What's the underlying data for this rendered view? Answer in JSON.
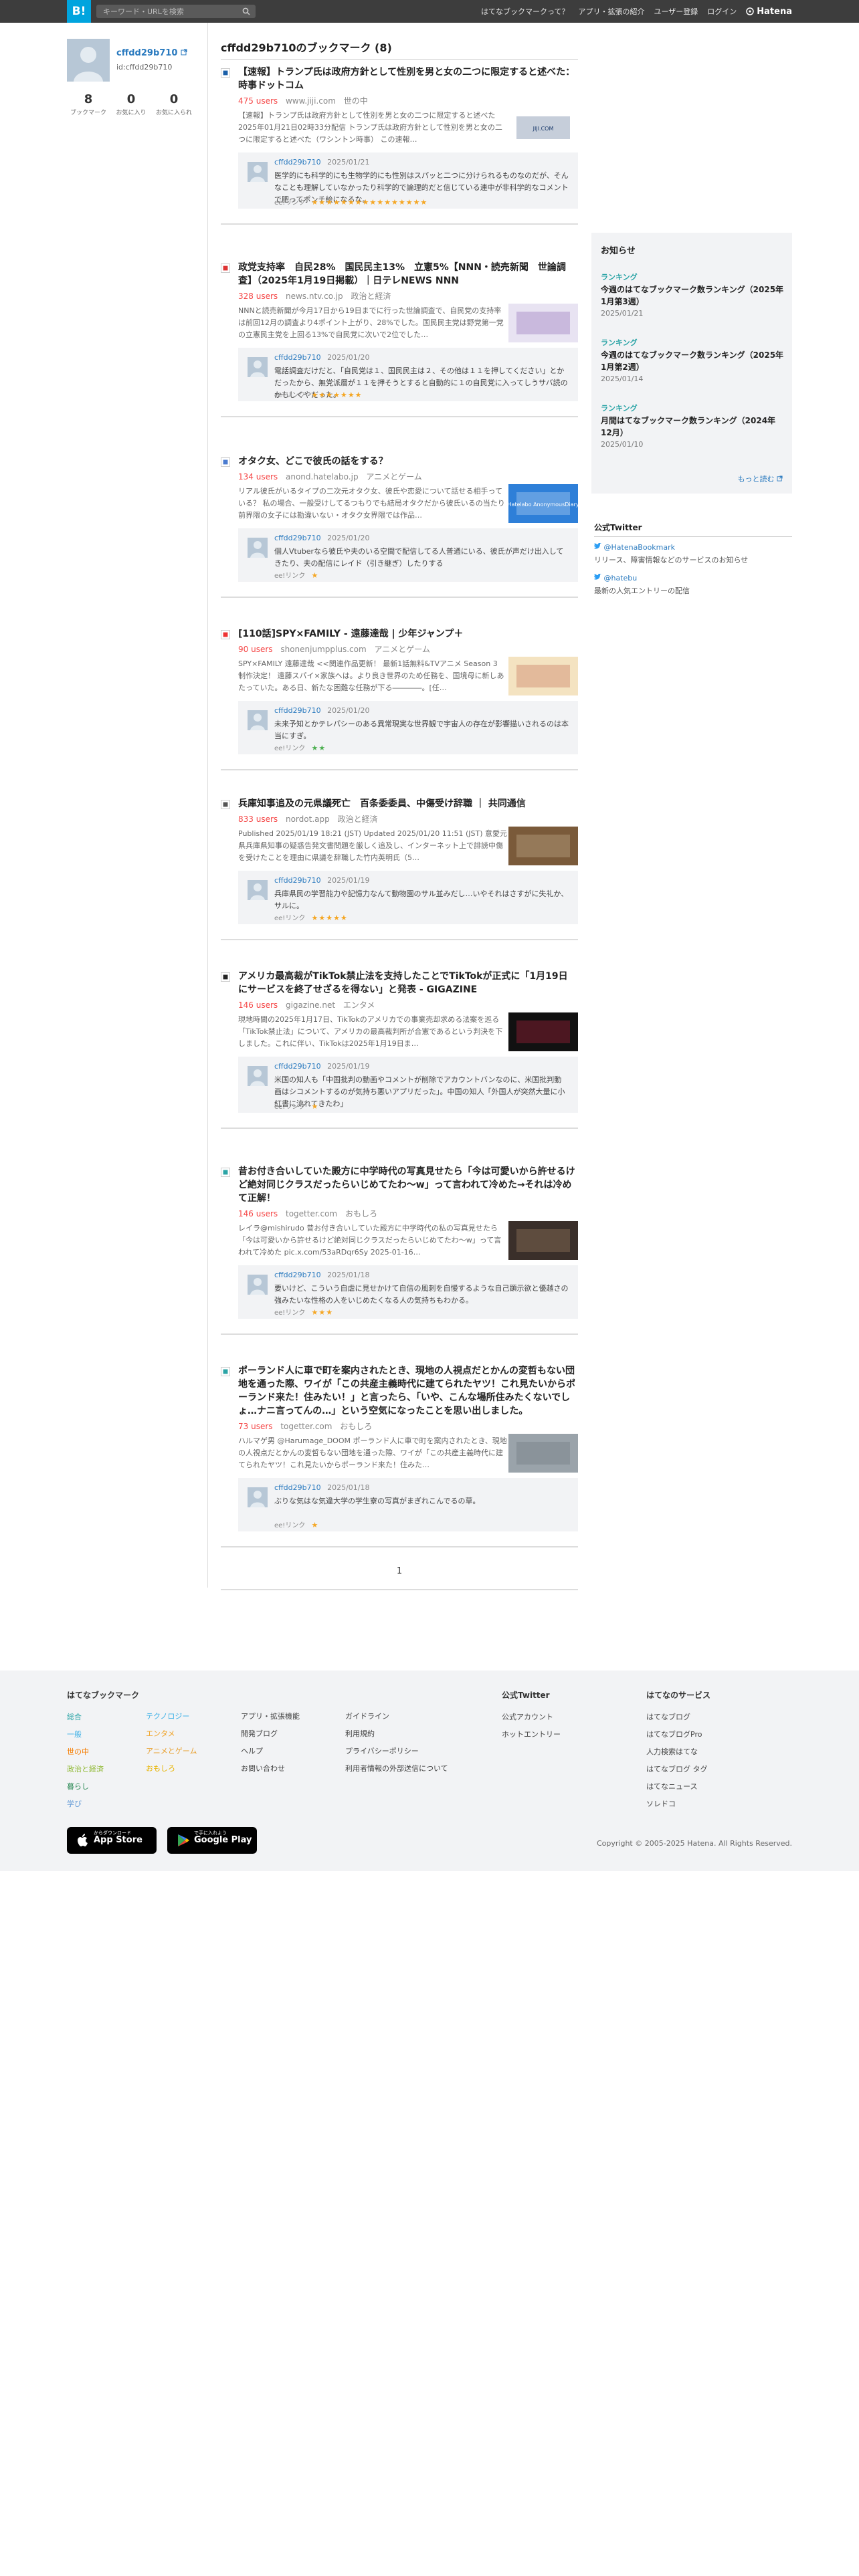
{
  "topbar": {
    "logo": "B!",
    "search_placeholder": "キーワード・URLを検索",
    "nav": [
      "はてなブックマークって？",
      "アプリ・拡張の紹介",
      "ユーザー登録",
      "ログイン"
    ],
    "brand": "Hatena"
  },
  "profile": {
    "name": "cffdd29b710",
    "id_text": "id:cffdd29b710",
    "stats": [
      {
        "value": "8",
        "label": "ブックマーク"
      },
      {
        "value": "0",
        "label": "お気に入り"
      },
      {
        "value": "0",
        "label": "お気に入られ"
      }
    ]
  },
  "main": {
    "title": "cffdd29b710のブックマーク (8)",
    "entries": [
      {
        "title": "【速報】トランプ氏は政府方針として性別を男と女の二つに限定すると述べた：時事ドットコム",
        "users": "475 users",
        "site": "www.jiji.com",
        "category": "世の中",
        "excerpt": "【速報】トランプ氏は政府方針として性別を男と女の二つに限定すると述べた 2025年01月21日02時33分配信 トランプ氏は政府方針として性別を男と女の二つに限定すると述べた（ワシントン時事） この速報…",
        "thumb_text": "JIJI.COM",
        "comment_user": "cffdd29b710",
        "comment_date": "2025/01/21",
        "comment_text": "医学的にも科学的にも生物学的にも性別はスパッと二つに分けられるものなのだが、そんなことも理解していなかったり科学的で論理的だと信じている連中が非科学的なコメントで肥ってポンチ絵になるな。",
        "tag": "ee!リンク",
        "stars": "★★★★★★★★★★★★★★★★",
        "star_color": "#f5a623"
      },
      {
        "title": "政党支持率　自民28%　国民民主13%　立憲5%【NNN・読売新聞　世論調査】（2025年1月19日掲載）｜日テレNEWS NNN",
        "users": "328 users",
        "site": "news.ntv.co.jp",
        "category": "政治と経済",
        "excerpt": "NNNと読売新聞が今月17日から19日までに行った世論調査で、自民党の支持率は前回12月の調査より4ポイント上がり、28%でした。国民民主党は野党第一党の立憲民主党を上回る13%で自民党に次いで2位でした…",
        "thumb_text": "",
        "comment_user": "cffdd29b710",
        "comment_date": "2025/01/20",
        "comment_text": "電話調査だけだと、「自民党は１、国民民主は２、その他は１１を押してください」とかだったから、無党派層が１１を押そうとすると自動的に１の自民党に入ってしうサバ読のかもしくやだった。",
        "tag": "ee!リンク",
        "stars": "★★★★★★★",
        "star_color": "#f5a623"
      },
      {
        "title": "オタク女、どこで彼氏の話をする？",
        "users": "134 users",
        "site": "anond.hatelabo.jp",
        "category": "アニメとゲーム",
        "excerpt": "リアル彼氏がいるタイプの二次元オタク女、彼氏や恋愛について話せる相手っている？ 私の場合、一般受けしてるつもりでも結局オタクだから彼氏いるの当たり前界隈の女子には勘違いない・オタク女界隈では作品…",
        "thumb_text": "Hatelabo AnonymousDiary",
        "comment_user": "cffdd29b710",
        "comment_date": "2025/01/20",
        "comment_text": "個人Vtuberなら彼氏や夫のいる空間で配信してる人普通にいる、彼氏が声だけ出入してきたり、夫の配信にレイド（引き継ぎ）したりする",
        "tag": "ee!リンク",
        "stars": "★",
        "star_color": "#f5a623"
      },
      {
        "title": "[110話]SPY×FAMILY - 遠藤達哉 | 少年ジャンプ＋",
        "users": "90 users",
        "site": "shonenjumpplus.com",
        "category": "アニメとゲーム",
        "excerpt": "SPY×FAMILY 遠藤達哉 <<関連作品更新！ 最新1話無料&TVアニメ Season 3 制作決定！ 遠藤スパイ×家族へは。より良き世界のため任務を、国境母に新しあたっていた。ある日、新たな困難な任務が下る――――。[任…",
        "thumb_text": "",
        "comment_user": "cffdd29b710",
        "comment_date": "2025/01/20",
        "comment_text": "未来予知とかテレパシーのある異常現実な世界観で宇宙人の存在が影響描いされるのは本当にすぎ。",
        "tag": "ee!リンク",
        "stars": "★★",
        "star_color": "#4caf50"
      },
      {
        "title": "兵庫知事追及の元県議死亡　百条委委員、中傷受け辞職 ｜ 共同通信",
        "users": "833 users",
        "site": "nordot.app",
        "category": "政治と経済",
        "excerpt": "Published 2025/01/19 18:21 (JST) Updated 2025/01/20 11:51 (JST) 意愛元県兵庫県知事の疑惑告発文書問題を厳しく追及し、インターネット上で誹謗中傷を受けたことを理由に県議を辞職した竹内英明氏（5…",
        "thumb_text": "",
        "comment_user": "cffdd29b710",
        "comment_date": "2025/01/19",
        "comment_text": "兵庫県民の学習能力や記憶力なんて動物園のサル並みだし…いやそれはさすがに失礼か、サルに。",
        "tag": "ee!リンク",
        "stars": "★★★★★",
        "star_color": "#f5a623"
      },
      {
        "title": "アメリカ最高裁がTikTok禁止法を支持したことでTikTokが正式に「1月19日にサービスを終了せざるを得ない」と発表 - GIGAZINE",
        "users": "146 users",
        "site": "gigazine.net",
        "category": "エンタメ",
        "excerpt": "現地時間の2025年1月17日、TikTokのアメリカでの事業売却求める法案を巡る「TikTok禁止法」について、アメリカの最高裁判所が合憲であるという判決を下しました。これに伴い、TikTokは2025年1月19日ま…",
        "thumb_text": "",
        "comment_user": "cffdd29b710",
        "comment_date": "2025/01/19",
        "comment_text": "米国の知人も「中国批判の動画やコメントが削除でアカウントバンなのに、米国批判動画はシコメントするのが気持ち悪いアプリだった」。中国の知人「外国人が突然大量に小紅書に流れてきたわ」",
        "tag": "ee!リンク",
        "stars": "★",
        "star_color": "#f5a623"
      },
      {
        "title": "昔お付き合いしていた殿方に中学時代の写真見せたら「今は可愛いから許せるけど絶対同じクラスだったらいじめてたわ〜w」って言われて冷めた→それは冷めて正解！",
        "users": "146 users",
        "site": "togetter.com",
        "category": "おもしろ",
        "excerpt": "レイラ@mishirudo 昔お付き合いしていた殿方に中学時代の私の写真見せたら「今は可愛いから許せるけど絶対同じクラスだったらいじめてたわ〜w」って言われて冷めた pic.x.com/53aRDqr6Sy 2025-01-16…",
        "thumb_text": "",
        "comment_user": "cffdd29b710",
        "comment_date": "2025/01/18",
        "comment_text": "要いけど、こういう自虐に見せかけて自信の風刺を自慢するような自己顕示欲と優越さの強みたいな性格の人をいじめたくなる人の気持ちもわかる。",
        "tag": "ee!リンク",
        "stars": "★★★",
        "star_color": "#f5a623"
      },
      {
        "title": "ポーランド人に車で町を案内されたとき、現地の人視点だとかんの変哲もない団地を通った際、ワイが「この共産主義時代に建てられたヤツ！これ見たいからポーランド来た！住みたい！」と言ったら、「いや、こんな場所住みたくないでしょ…ナニ言ってんの…」という空気になったことを思い出しました。",
        "users": "73 users",
        "site": "togetter.com",
        "category": "おもしろ",
        "excerpt": "ハルマゲ男 @Harumage_DOOM ポーランド人に車で町を案内されたとき、現地の人視点だとかんの変哲もない団地を通った際、ワイが「この共産主義時代に建てられたヤツ！これ見たいからポーランド来た！住みた…",
        "thumb_text": "",
        "comment_user": "cffdd29b710",
        "comment_date": "2025/01/18",
        "comment_text": "ぶりな気はな気違大学の学生寮の写真がまぎれこんでるの草。",
        "tag": "ee!リンク",
        "stars": "★",
        "star_color": "#f5a623"
      }
    ],
    "pager": "1"
  },
  "notice": {
    "title": "お知らせ",
    "items": [
      {
        "label": "ランキング",
        "text": "今週のはてなブックマーク数ランキング（2025年1月第3週）",
        "date": "2025/01/21"
      },
      {
        "label": "ランキング",
        "text": "今週のはてなブックマーク数ランキング（2025年1月第2週）",
        "date": "2025/01/14"
      },
      {
        "label": "ランキング",
        "text": "月間はてなブックマーク数ランキング（2024年12月）",
        "date": "2025/01/10"
      }
    ],
    "more": "もっと読む"
  },
  "twitter": {
    "title": "公式Twitter",
    "accounts": [
      {
        "handle": "@HatenaBookmark",
        "desc": "リリース、障害情報などのサービスのお知らせ"
      },
      {
        "handle": "@hatebu",
        "desc": "最新の人気エントリーの配信"
      }
    ]
  },
  "footer": {
    "col1_title": "はてなブックマーク",
    "col1a": [
      "総合",
      "一般",
      "世の中",
      "政治と経済",
      "暮らし",
      "学び"
    ],
    "col1b": [
      "テクノロジー",
      "エンタメ",
      "アニメとゲーム",
      "おもしろ"
    ],
    "col1c": [
      "アプリ・拡張機能",
      "開発ブログ",
      "ヘルプ",
      "お問い合わせ"
    ],
    "col1d": [
      "ガイドライン",
      "利用規約",
      "プライバシーポリシー",
      "利用者情報の外部送信について"
    ],
    "col2_title": "公式Twitter",
    "col2": [
      "公式アカウント",
      "ホットエントリー"
    ],
    "col3_title": "はてなのサービス",
    "col3": [
      "はてなブログ",
      "はてなブログPro",
      "人力検索はてな",
      "はてなブログ タグ",
      "はてなニュース",
      "ソレドコ"
    ],
    "appstore_small": "からダウンロード",
    "appstore_big": "App Store",
    "googleplay_small": "で手に入れよう",
    "googleplay_big": "Google Play",
    "copyright": "Copyright © 2005-2025 Hatena. All Rights Reserved."
  },
  "colors": {
    "topbar": "#3d3d3d",
    "logo": "#00a4de",
    "link": "#2a7abf",
    "users": "#f54545",
    "notice_label": "#2ba4a6"
  }
}
